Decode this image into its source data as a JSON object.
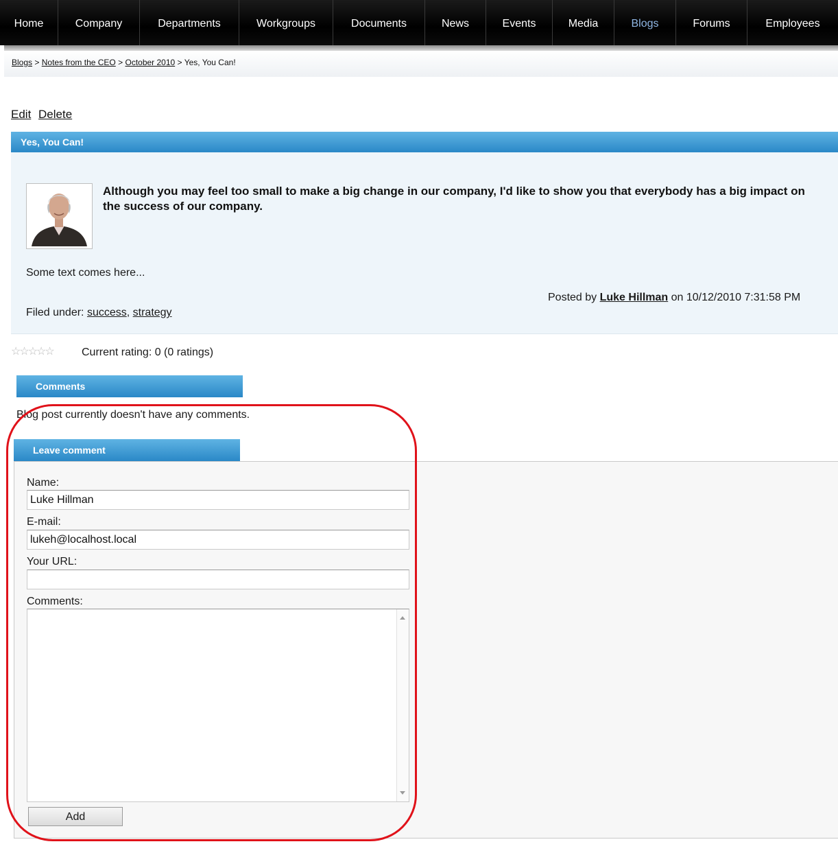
{
  "nav": {
    "items": [
      "Home",
      "Company",
      "Departments",
      "Workgroups",
      "Documents",
      "News",
      "Events",
      "Media",
      "Blogs",
      "Forums",
      "Employees"
    ],
    "active": "Blogs"
  },
  "breadcrumb": {
    "blogs": "Blogs",
    "blog": "Notes from the CEO",
    "month": "October 2010",
    "current": "Yes, You Can!",
    "separator": ">"
  },
  "actions": {
    "edit": "Edit",
    "delete": "Delete"
  },
  "post": {
    "title": "Yes, You Can!",
    "lead": "Although you may feel too small to make a big change in our company, I'd like to show you that everybody has a big impact on the success of our company.",
    "body": "Some text comes here...",
    "posted_by_prefix": "Posted by",
    "author": "Luke Hillman",
    "posted_on": "on 10/12/2010 7:31:58 PM",
    "filed_under_label": "Filed under:",
    "tags": [
      "success",
      "strategy"
    ]
  },
  "rating": {
    "text": "Current rating: 0 (0 ratings)",
    "stars": 5,
    "value": 0
  },
  "comments": {
    "tab_label": "Comments",
    "empty_text": "Blog post currently doesn't have any comments."
  },
  "leave_comment": {
    "tab_label": "Leave comment",
    "name_label": "Name:",
    "name_value": "Luke Hillman",
    "email_label": "E-mail:",
    "email_value": "lukeh@localhost.local",
    "url_label": "Your URL:",
    "url_value": "",
    "comments_label": "Comments:",
    "comments_value": "",
    "add_label": "Add"
  },
  "colors": {
    "accent": "#2a88c7",
    "highlight": "#e0121a",
    "nav_active": "#8fb6e3"
  }
}
